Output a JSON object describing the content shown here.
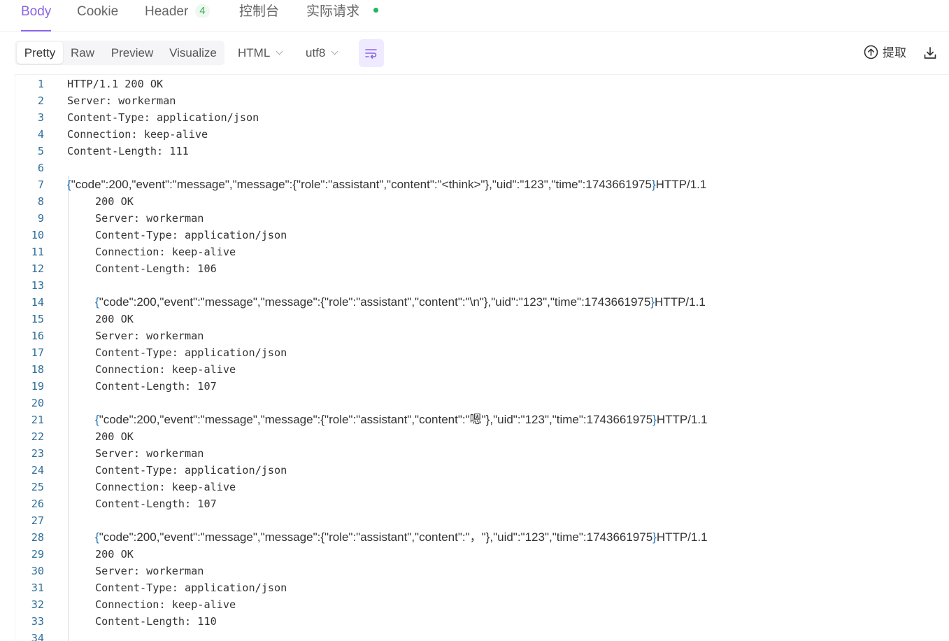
{
  "tabs": [
    {
      "label": "Body",
      "active": true
    },
    {
      "label": "Cookie"
    },
    {
      "label": "Header",
      "badge": "4"
    },
    {
      "label": "控制台"
    },
    {
      "label": "实际请求",
      "status": "green-dot"
    }
  ],
  "toolbar": {
    "view_modes": [
      "Pretty",
      "Raw",
      "Preview",
      "Visualize"
    ],
    "active_view": "Pretty",
    "format": "HTML",
    "encoding": "utf8",
    "wrap_icon": "word-wrap-icon",
    "extract_label": "提取",
    "download_icon": "download-icon",
    "accent": "#8a63e8"
  },
  "code": {
    "lines": [
      {
        "n": "1",
        "text": "HTTP/1.1 200 OK"
      },
      {
        "n": "2",
        "text": "Server: workerman"
      },
      {
        "n": "3",
        "text": "Content-Type: application/json"
      },
      {
        "n": "4",
        "text": "Connection: keep-alive"
      },
      {
        "n": "5",
        "text": "Content-Length: 111"
      },
      {
        "n": "6",
        "text": ""
      },
      {
        "n": "7",
        "json": true,
        "pre": "",
        "body": "\"code\":200,\"event\":\"message\",\"message\":{\"role\":\"assistant\",\"content\":\"<think>\"},\"uid\":\"123\",\"time\":1743661975",
        "post": "HTTP/1.1"
      },
      {
        "n": "8",
        "text": "200 OK",
        "indent": true
      },
      {
        "n": "9",
        "text": "Server: workerman",
        "indent": true
      },
      {
        "n": "10",
        "text": "Content-Type: application/json",
        "indent": true
      },
      {
        "n": "11",
        "text": "Connection: keep-alive",
        "indent": true
      },
      {
        "n": "12",
        "text": "Content-Length: 106",
        "indent": true
      },
      {
        "n": "13",
        "text": ""
      },
      {
        "n": "14",
        "json": true,
        "indent": true,
        "body": "\"code\":200,\"event\":\"message\",\"message\":{\"role\":\"assistant\",\"content\":\"\\n\"},\"uid\":\"123\",\"time\":1743661975",
        "post": "HTTP/1.1"
      },
      {
        "n": "15",
        "text": "200 OK",
        "indent": true
      },
      {
        "n": "16",
        "text": "Server: workerman",
        "indent": true
      },
      {
        "n": "17",
        "text": "Content-Type: application/json",
        "indent": true
      },
      {
        "n": "18",
        "text": "Connection: keep-alive",
        "indent": true
      },
      {
        "n": "19",
        "text": "Content-Length: 107",
        "indent": true
      },
      {
        "n": "20",
        "text": ""
      },
      {
        "n": "21",
        "json": true,
        "indent": true,
        "body": "\"code\":200,\"event\":\"message\",\"message\":{\"role\":\"assistant\",\"content\":\"嗯\"},\"uid\":\"123\",\"time\":1743661975",
        "post": "HTTP/1.1"
      },
      {
        "n": "22",
        "text": "200 OK",
        "indent": true
      },
      {
        "n": "23",
        "text": "Server: workerman",
        "indent": true
      },
      {
        "n": "24",
        "text": "Content-Type: application/json",
        "indent": true
      },
      {
        "n": "25",
        "text": "Connection: keep-alive",
        "indent": true
      },
      {
        "n": "26",
        "text": "Content-Length: 107",
        "indent": true
      },
      {
        "n": "27",
        "text": ""
      },
      {
        "n": "28",
        "json": true,
        "indent": true,
        "body": "\"code\":200,\"event\":\"message\",\"message\":{\"role\":\"assistant\",\"content\":\"，\"},\"uid\":\"123\",\"time\":1743661975",
        "post": "HTTP/1.1"
      },
      {
        "n": "29",
        "text": "200 OK",
        "indent": true
      },
      {
        "n": "30",
        "text": "Server: workerman",
        "indent": true
      },
      {
        "n": "31",
        "text": "Content-Type: application/json",
        "indent": true
      },
      {
        "n": "32",
        "text": "Connection: keep-alive",
        "indent": true
      },
      {
        "n": "33",
        "text": "Content-Length: 110",
        "indent": true
      },
      {
        "n": "34",
        "text": ""
      }
    ]
  }
}
